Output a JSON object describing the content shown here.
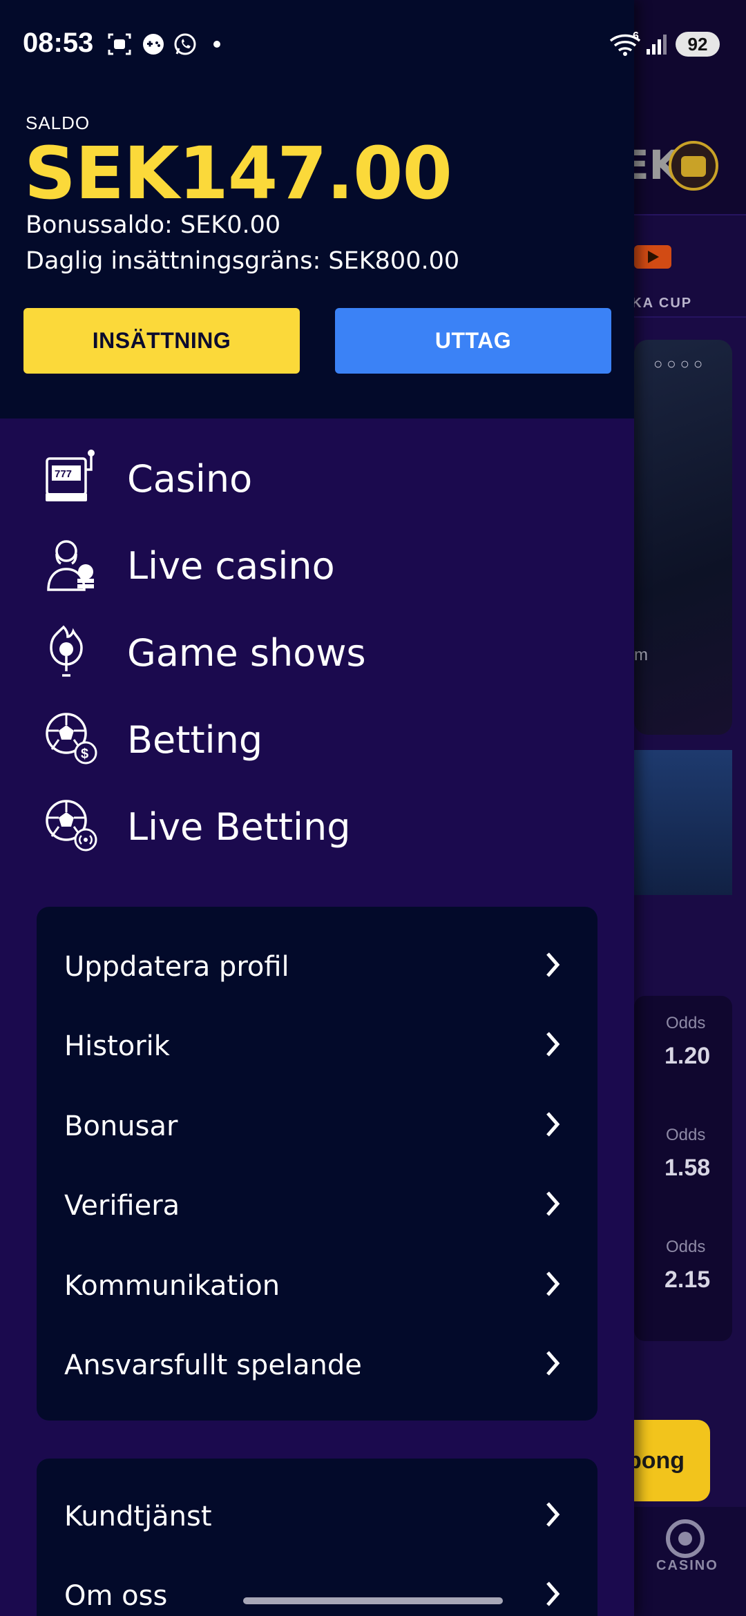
{
  "status_bar": {
    "time": "08:53",
    "battery": "92",
    "signal_label": "6"
  },
  "background": {
    "brand_fragment": "EK",
    "nav_label": "TKA CUP",
    "card_text": "m",
    "odds": [
      {
        "label": "Odds",
        "value": "1.20"
      },
      {
        "label": "Odds",
        "value": "1.58"
      },
      {
        "label": "Odds",
        "value": "2.15"
      }
    ],
    "cta_fragment": "pong",
    "bottom_nav_label": "CASINO"
  },
  "account": {
    "saldo_label": "SALDO",
    "saldo_amount": "SEK147.00",
    "bonus_line": "Bonussaldo: SEK0.00",
    "limit_line": "Daglig insättningsgräns: SEK800.00",
    "deposit_label": "INSÄTTNING",
    "withdraw_label": "UTTAG"
  },
  "categories": [
    {
      "label": "Casino",
      "icon": "slot-machine-icon"
    },
    {
      "label": "Live casino",
      "icon": "dealer-icon"
    },
    {
      "label": "Game shows",
      "icon": "microphone-icon"
    },
    {
      "label": "Betting",
      "icon": "soccer-ball-dollar-icon"
    },
    {
      "label": "Live Betting",
      "icon": "soccer-ball-live-icon"
    }
  ],
  "menu_primary": [
    {
      "label": "Uppdatera profil"
    },
    {
      "label": "Historik"
    },
    {
      "label": "Bonusar"
    },
    {
      "label": "Verifiera"
    },
    {
      "label": "Kommunikation"
    },
    {
      "label": "Ansvarsfullt spelande"
    }
  ],
  "menu_secondary": [
    {
      "label": "Kundtjänst"
    },
    {
      "label": "Om oss"
    }
  ],
  "colors": {
    "accent_yellow": "#fbd93a",
    "accent_blue": "#3b82f6",
    "drawer_top": "#030a2a",
    "drawer_body": "#1b0a4e"
  }
}
